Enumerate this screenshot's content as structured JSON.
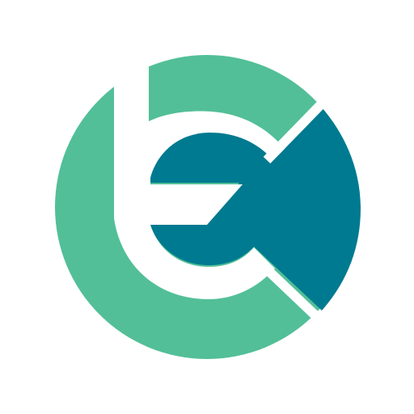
{
  "logo": {
    "icon": "tc-monogram-logo-icon",
    "colors": {
      "background": "#ffffff",
      "primary_green": "#52bf98",
      "primary_teal": "#007a90",
      "separator": "#ffffff"
    }
  }
}
